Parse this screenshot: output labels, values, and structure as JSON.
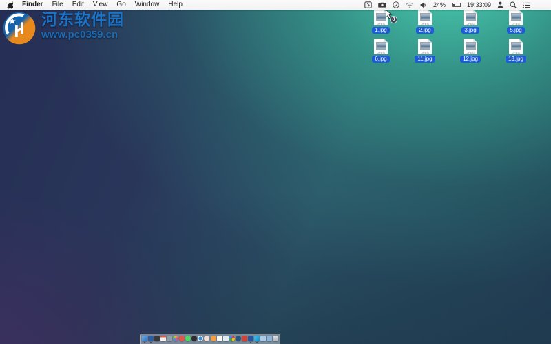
{
  "menu_bar": {
    "items": [
      "Finder",
      "File",
      "Edit",
      "View",
      "Go",
      "Window",
      "Help"
    ],
    "status": {
      "battery_percent": "24%",
      "battery_level": 24,
      "time": "19:33:09"
    },
    "icons": [
      "screen",
      "camera",
      "check-circle",
      "wifi",
      "volume",
      "battery",
      "user",
      "search",
      "notification-list"
    ]
  },
  "watermark": {
    "site_name": "河东软件园",
    "site_url": "www.pc0359.cn",
    "title_color": "#1b74c9",
    "url_color": "#186bb4"
  },
  "desktop": {
    "selection_color": "#1d5bd8",
    "file_type_badge": "JPEG",
    "drag_count": "8",
    "files": [
      {
        "label": "1.jpg"
      },
      {
        "label": "2.jpg"
      },
      {
        "label": "3.jpg"
      },
      {
        "label": "5.jpg"
      },
      {
        "label": "6.jpg"
      },
      {
        "label": "11.jpg"
      },
      {
        "label": "12.jpg"
      },
      {
        "label": "13.jpg"
      }
    ]
  },
  "dock": {
    "items": [
      {
        "name": "finder",
        "color": "linear-gradient(135deg,#6db3e8,#2f6fc0)",
        "shape": "square",
        "running": true
      },
      {
        "name": "app-2",
        "color": "#2e5e9e",
        "shape": "square",
        "running": true
      },
      {
        "name": "app-3",
        "color": "#3a3a3e",
        "shape": "square",
        "running": false
      },
      {
        "name": "app-4",
        "color": "linear-gradient(180deg,#e2574c 32%,#f5f2ec 32%)",
        "shape": "square",
        "running": false
      },
      {
        "name": "app-5",
        "color": "#8f9ea8",
        "shape": "square",
        "running": false
      },
      {
        "name": "app-6",
        "color": "conic-gradient(#f3c14b,#e2574c,#b05fc0,#4a90d9,#58b85c,#f3c14b)",
        "shape": "circle",
        "running": false
      },
      {
        "name": "app-7",
        "color": "#e2574c",
        "shape": "circle",
        "running": false
      },
      {
        "name": "app-8",
        "color": "#4cd964",
        "shape": "circle",
        "running": false
      },
      {
        "name": "app-9",
        "color": "#2d2d31",
        "shape": "circle",
        "running": false
      },
      {
        "name": "app-10",
        "color": "radial-gradient(circle,#2f8fe0 45%,#f2f2f2 46%)",
        "shape": "circle",
        "running": false
      },
      {
        "name": "app-11",
        "color": "#f3dcd8",
        "shape": "circle",
        "running": false
      },
      {
        "name": "app-12",
        "color": "#f59e3d",
        "shape": "circle",
        "running": false
      },
      {
        "name": "app-13",
        "color": "#f7f7f5",
        "shape": "square",
        "running": false
      },
      {
        "name": "app-14",
        "color": "#dfeaf2",
        "shape": "square",
        "running": false
      },
      {
        "name": "app-15",
        "color": "conic-gradient(#ea4335 0 25%, #fbbc05 25% 50%, #34a853 50% 75%, #4285f4 75% 100%)",
        "shape": "circle",
        "running": false
      },
      {
        "name": "app-16",
        "color": "#28577f",
        "shape": "circle",
        "running": false
      },
      {
        "name": "app-17",
        "color": "#cc4437",
        "shape": "square",
        "running": false
      },
      {
        "name": "app-18",
        "color": "#2b579a",
        "shape": "square",
        "running": true
      },
      {
        "name": "app-19",
        "color": "linear-gradient(135deg,#3fc1f0,#0f8fd0)",
        "shape": "square",
        "running": true
      },
      {
        "name": "app-20",
        "color": "#a9cbe8",
        "shape": "square",
        "running": false
      },
      {
        "name": "app-21",
        "color": "#8fb4d9",
        "shape": "square",
        "running": false
      },
      {
        "name": "trash",
        "color": "linear-gradient(180deg,#dfe3e8,#aab2bb)",
        "shape": "square",
        "running": false
      }
    ]
  }
}
